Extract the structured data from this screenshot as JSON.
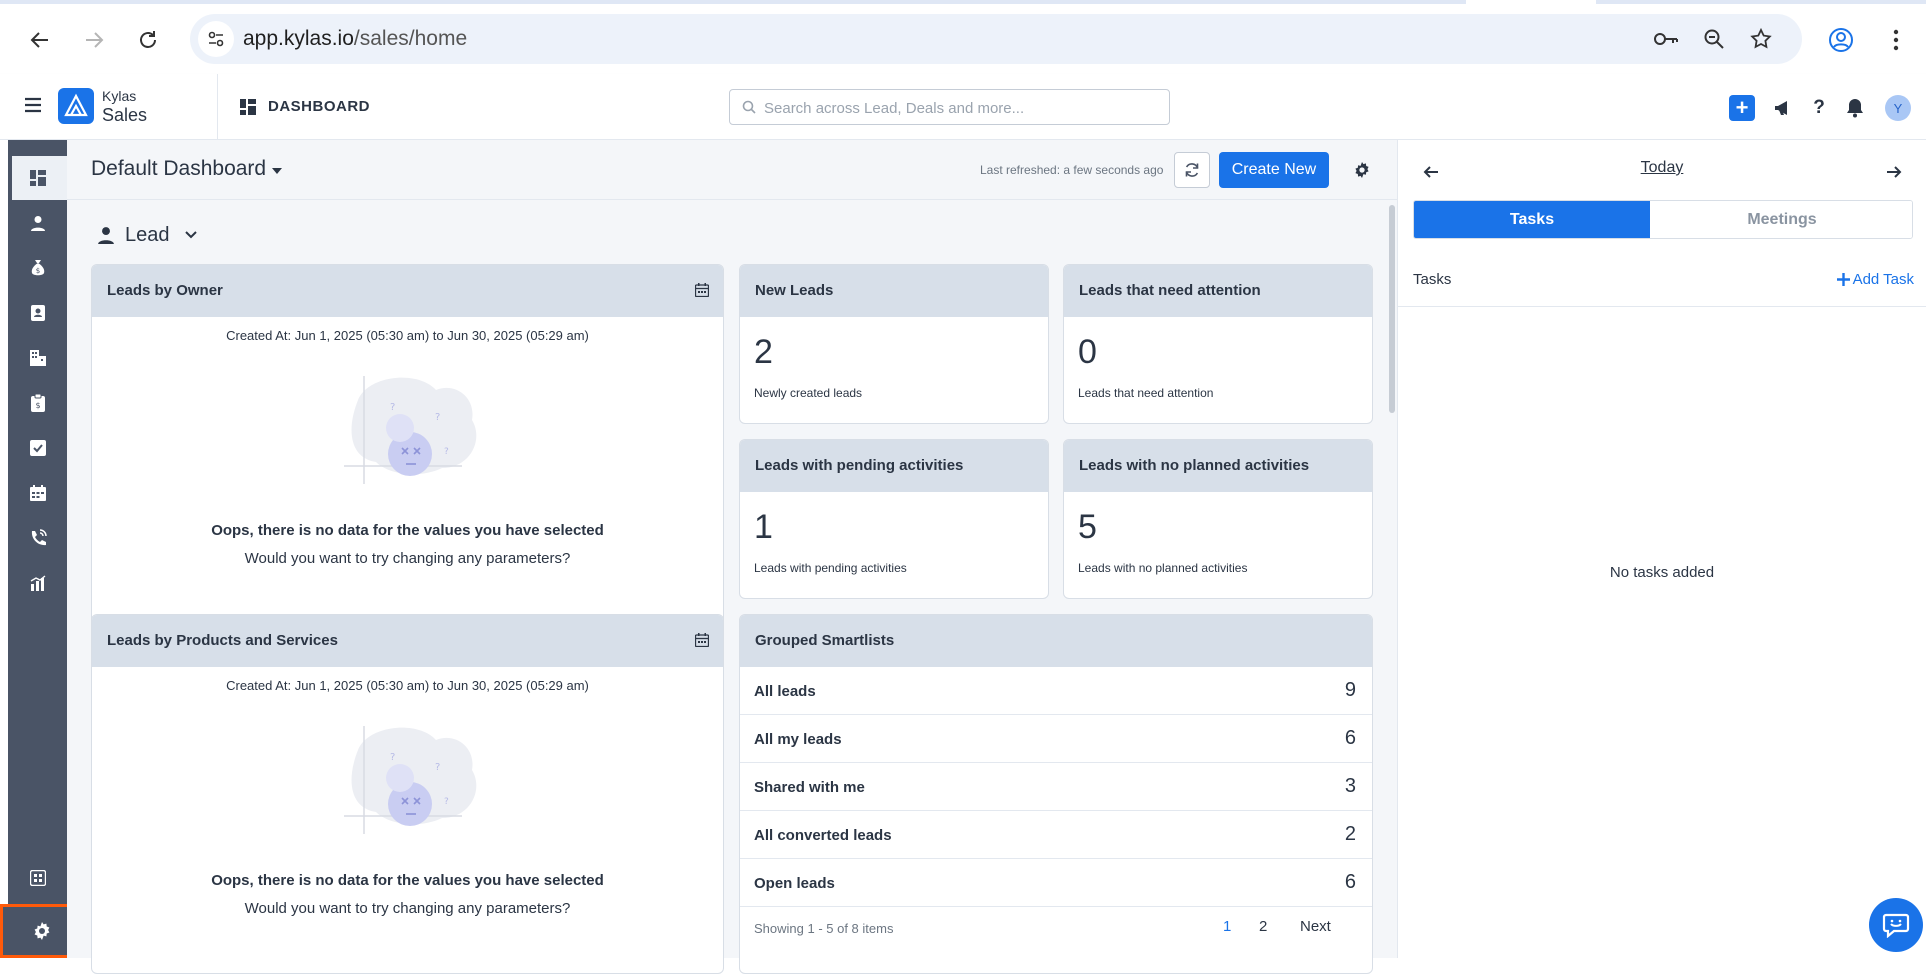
{
  "browser": {
    "url_host": "app.kylas.io",
    "url_path": "/sales/home"
  },
  "appbar": {
    "brand_top": "Kylas",
    "brand_bottom": "Sales",
    "section": "DASHBOARD",
    "search_placeholder": "Search across Lead, Deals and more...",
    "avatar_initial": "Y",
    "add_label": "+",
    "help_label": "?"
  },
  "dashboard": {
    "title": "Default Dashboard",
    "last_refreshed": "Last refreshed: a few seconds ago",
    "create_new": "Create New",
    "section": "Lead"
  },
  "cards": {
    "leads_by_owner": {
      "title": "Leads by Owner",
      "created_at": "Created At: Jun 1, 2025 (05:30 am) to Jun 30, 2025 (05:29 am)",
      "oops": "Oops, there is no data for the values you have selected",
      "try": "Would you want to try changing any parameters?"
    },
    "leads_by_products": {
      "title": "Leads by Products and Services",
      "created_at": "Created At: Jun 1, 2025 (05:30 am) to Jun 30, 2025 (05:29 am)",
      "oops": "Oops, there is no data for the values you have selected",
      "try": "Would you want to try changing any parameters?"
    },
    "new_leads": {
      "title": "New Leads",
      "value": "2",
      "sub": "Newly created leads"
    },
    "need_attention": {
      "title": "Leads that need attention",
      "value": "0",
      "sub": "Leads that need attention"
    },
    "pending_activities": {
      "title": "Leads with pending activities",
      "value": "1",
      "sub": "Leads with pending activities"
    },
    "no_planned": {
      "title": "Leads with no planned activities",
      "value": "5",
      "sub": "Leads with no planned activities"
    }
  },
  "smartlists": {
    "title": "Grouped Smartlists",
    "rows": [
      {
        "name": "All leads",
        "count": "9"
      },
      {
        "name": "All my leads",
        "count": "6"
      },
      {
        "name": "Shared with me",
        "count": "3"
      },
      {
        "name": "All converted leads",
        "count": "2"
      },
      {
        "name": "Open leads",
        "count": "6"
      }
    ],
    "showing": "Showing 1 - 5 of 8 items",
    "page1": "1",
    "page2": "2",
    "next": "Next"
  },
  "right_panel": {
    "today": "Today",
    "tab_tasks": "Tasks",
    "tab_meetings": "Meetings",
    "tasks_label": "Tasks",
    "add_task": "Add Task",
    "empty": "No tasks added"
  },
  "colors": {
    "accent": "#1a73e8",
    "sidebar": "#4a5466",
    "card_header": "#d7dfe9",
    "highlight": "#ff5a0a"
  }
}
